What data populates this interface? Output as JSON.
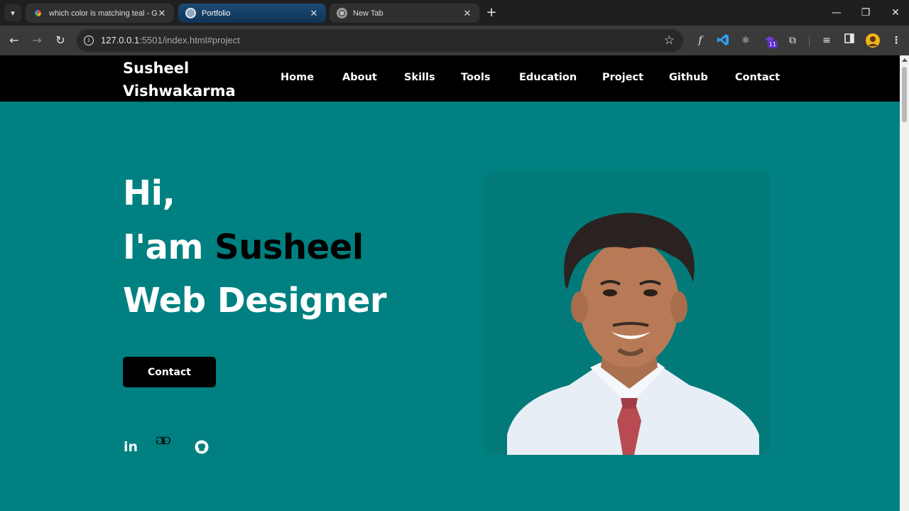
{
  "browser": {
    "tabs": [
      {
        "title": "which color is matching teal - Goo",
        "active": false
      },
      {
        "title": "Portfolio",
        "active": true
      },
      {
        "title": "New Tab",
        "active": false
      }
    ],
    "url_host": "127.0.0.1",
    "url_rest": ":5501/index.html#project",
    "extension_badge": "11"
  },
  "site": {
    "brand_line1": "Susheel",
    "brand_line2": "Vishwakarma",
    "nav": [
      "Home",
      "About",
      "Skills",
      "Tools",
      "Education",
      "Project",
      "Github",
      "Contact"
    ],
    "hero_hi": "Hi,",
    "hero_iam": "I'am ",
    "hero_name": "Susheel",
    "hero_role": "Web Designer",
    "contact_button": "Contact",
    "social_linkedin": "in",
    "social_gfg": "GfG"
  },
  "colors": {
    "teal": "#008080",
    "nav_bg": "#000000",
    "accent_text": "#000000"
  },
  "icons": [
    "chevron-down-icon",
    "google-icon",
    "globe-icon",
    "chrome-icon",
    "close-icon",
    "plus-icon",
    "minimize-icon",
    "restore-icon",
    "back-icon",
    "forward-icon",
    "reload-icon",
    "info-icon",
    "star-icon",
    "extensions-icon",
    "linkedin-icon",
    "geeksforgeeks-icon",
    "github-icon"
  ]
}
